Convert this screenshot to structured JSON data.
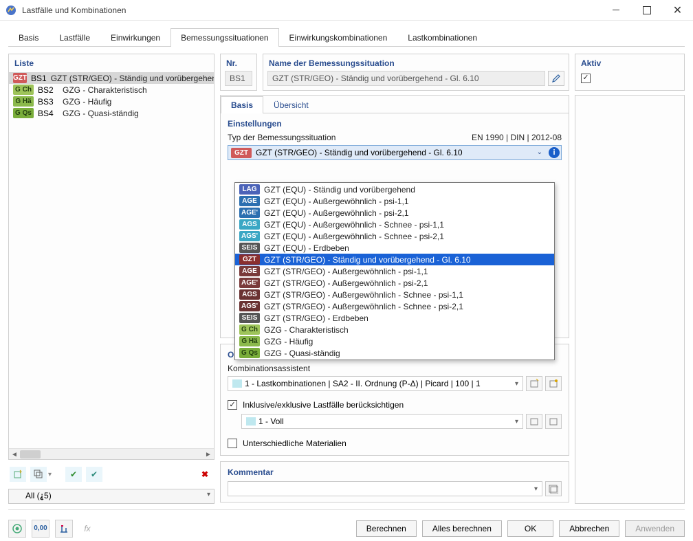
{
  "window": {
    "title": "Lastfälle und Kombinationen"
  },
  "tabs": [
    "Basis",
    "Lastfälle",
    "Einwirkungen",
    "Bemessungssituationen",
    "Einwirkungskombinationen",
    "Lastkombinationen"
  ],
  "active_tab": "Bemessungssituationen",
  "list": {
    "title": "Liste",
    "items": [
      {
        "tag": "GZT",
        "tag_class": "tag-gzt",
        "code": "BS1",
        "label": "GZT (STR/GEO) - Ständig und vorübergehend",
        "selected": true
      },
      {
        "tag": "G Ch",
        "tag_class": "tag-gch",
        "code": "BS2",
        "label": "GZG - Charakteristisch",
        "selected": false
      },
      {
        "tag": "G Hä",
        "tag_class": "tag-gha",
        "code": "BS3",
        "label": "GZG - Häufig",
        "selected": false
      },
      {
        "tag": "G Qs",
        "tag_class": "tag-gqs",
        "code": "BS4",
        "label": "GZG - Quasi-ständig",
        "selected": false
      }
    ],
    "filter": "All (⸘5)"
  },
  "nr": {
    "title": "Nr.",
    "value": "BS1"
  },
  "name": {
    "title": "Name der Bemessungssituation",
    "value": "GZT (STR/GEO) - Ständig und vorübergehend - Gl. 6.10"
  },
  "active": {
    "title": "Aktiv",
    "checked": true
  },
  "subtabs": [
    "Basis",
    "Übersicht"
  ],
  "active_subtab": "Basis",
  "settings": {
    "title": "Einstellungen",
    "type_label": "Typ der Bemessungssituation",
    "norm": "EN 1990 | DIN | 2012-08",
    "selected": {
      "tag": "GZT",
      "tag_class": "tag-gzt",
      "label": "GZT (STR/GEO) - Ständig und vorübergehend - Gl. 6.10"
    },
    "dropdown": [
      {
        "tag": "LAG",
        "tag_class": "tag-lag",
        "label": "GZT (EQU) - Ständig und vorübergehend"
      },
      {
        "tag": "AGE",
        "tag_class": "tag-age",
        "label": "GZT (EQU) - Außergewöhnlich - psi-1,1"
      },
      {
        "tag": "AGE'",
        "tag_class": "tag-agep",
        "label": "GZT (EQU) - Außergewöhnlich - psi-2,1"
      },
      {
        "tag": "AGS",
        "tag_class": "tag-ags",
        "label": "GZT (EQU) - Außergewöhnlich - Schnee - psi-1,1"
      },
      {
        "tag": "AGS'",
        "tag_class": "tag-agsp",
        "label": "GZT (EQU) - Außergewöhnlich - Schnee - psi-2,1"
      },
      {
        "tag": "SEIS",
        "tag_class": "tag-seis",
        "label": "GZT (EQU) - Erdbeben"
      },
      {
        "tag": "GZT",
        "tag_class": "tag-gzt-dark",
        "label": "GZT (STR/GEO) - Ständig und vorübergehend - Gl. 6.10",
        "highlight": true
      },
      {
        "tag": "AGE",
        "tag_class": "tag-age-dark",
        "label": "GZT (STR/GEO) - Außergewöhnlich - psi-1,1"
      },
      {
        "tag": "AGE'",
        "tag_class": "tag-age-dark",
        "label": "GZT (STR/GEO) - Außergewöhnlich - psi-2,1"
      },
      {
        "tag": "AGS",
        "tag_class": "tag-ags-dark",
        "label": "GZT (STR/GEO) - Außergewöhnlich - Schnee - psi-1,1"
      },
      {
        "tag": "AGS'",
        "tag_class": "tag-ags-dark",
        "label": "GZT (STR/GEO) - Außergewöhnlich - Schnee - psi-2,1"
      },
      {
        "tag": "SEIS",
        "tag_class": "tag-seis",
        "label": "GZT (STR/GEO) - Erdbeben"
      },
      {
        "tag": "G Ch",
        "tag_class": "tag-gch",
        "label": "GZG - Charakteristisch"
      },
      {
        "tag": "G Hä",
        "tag_class": "tag-gha",
        "label": "GZG - Häufig"
      },
      {
        "tag": "G Qs",
        "tag_class": "tag-gqs",
        "label": "GZG - Quasi-ständig"
      }
    ]
  },
  "options": {
    "title": "Optionen",
    "assistant_label": "Kombinationsassistent",
    "assistant_value": "1 - Lastkombinationen | SA2 - II. Ordnung (P-Δ) | Picard | 100 | 1",
    "include_label": "Inklusive/exklusive Lastfälle berücksichtigen",
    "include_checked": true,
    "include_value": "1 - Voll",
    "materials_label": "Unterschiedliche Materialien",
    "materials_checked": false
  },
  "comment": {
    "title": "Kommentar"
  },
  "buttons": {
    "calculate": "Berechnen",
    "calculate_all": "Alles berechnen",
    "ok": "OK",
    "cancel": "Abbrechen",
    "apply": "Anwenden"
  }
}
